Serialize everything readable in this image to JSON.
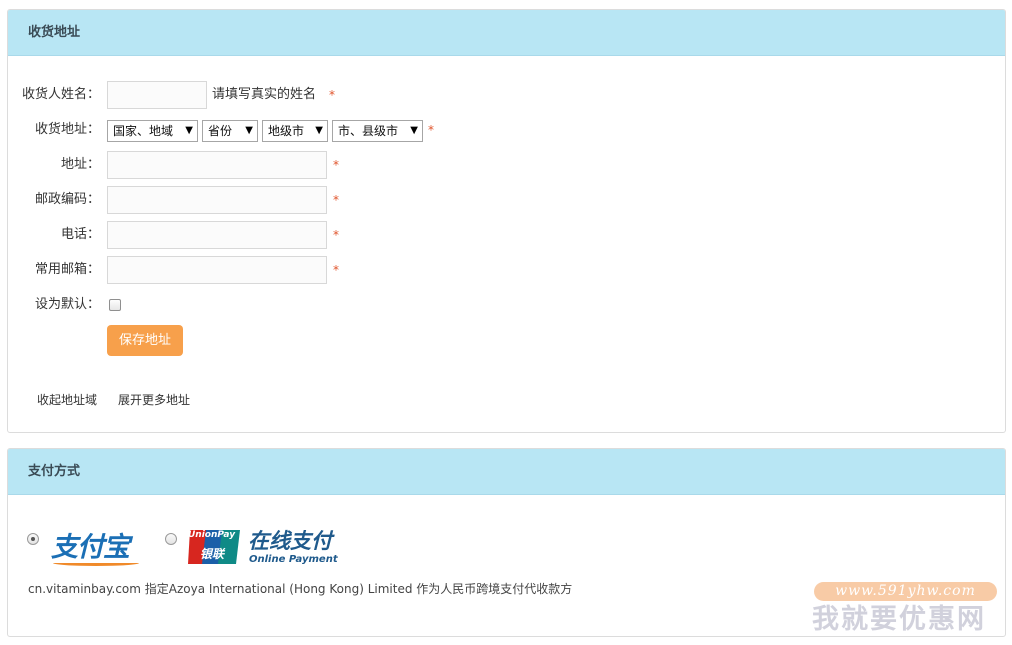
{
  "address_panel": {
    "title": "收货地址",
    "fields": {
      "name_label": "收货人姓名：",
      "name_hint": "请填写真实的姓名",
      "region_label": "收货地址：",
      "street_label": "地址：",
      "postcode_label": "邮政编码：",
      "phone_label": "电话：",
      "email_label": "常用邮箱：",
      "default_label": "设为默认："
    },
    "required_mark": "*",
    "selects": {
      "country": "国家、地域",
      "province": "省份",
      "city": "地级市",
      "district": "市、县级市",
      "arrow": "▼"
    },
    "name_value": "",
    "street_value": "",
    "postcode_value": "",
    "phone_value": "",
    "email_value": "",
    "default_checked": false,
    "save_button": "保存地址",
    "collapse_link": "收起地址域",
    "expand_link": "展开更多地址"
  },
  "payment_panel": {
    "title": "支付方式",
    "options": [
      {
        "name": "支付宝",
        "selected": true
      },
      {
        "name": "在线支付",
        "selected": false
      }
    ],
    "unionpay_logo_text": "UnionPay",
    "unionpay_logo_cn": "银联",
    "unionpay_sub": "Online Payment",
    "note": "cn.vitaminbay.com 指定Azoya International (Hong Kong) Limited 作为人民币跨境支付代收款方"
  },
  "watermark": {
    "url": "www.591yhw.com",
    "text": "我就要优惠网"
  },
  "colors": {
    "panel_header": "#b8e6f4",
    "save_button": "#f7a04b",
    "required": "#e0542c",
    "alipay_blue": "#1b6fb5",
    "unionpay_red": "#d7261f",
    "unionpay_blue": "#1b5fa8",
    "unionpay_green": "#0f8a86"
  }
}
